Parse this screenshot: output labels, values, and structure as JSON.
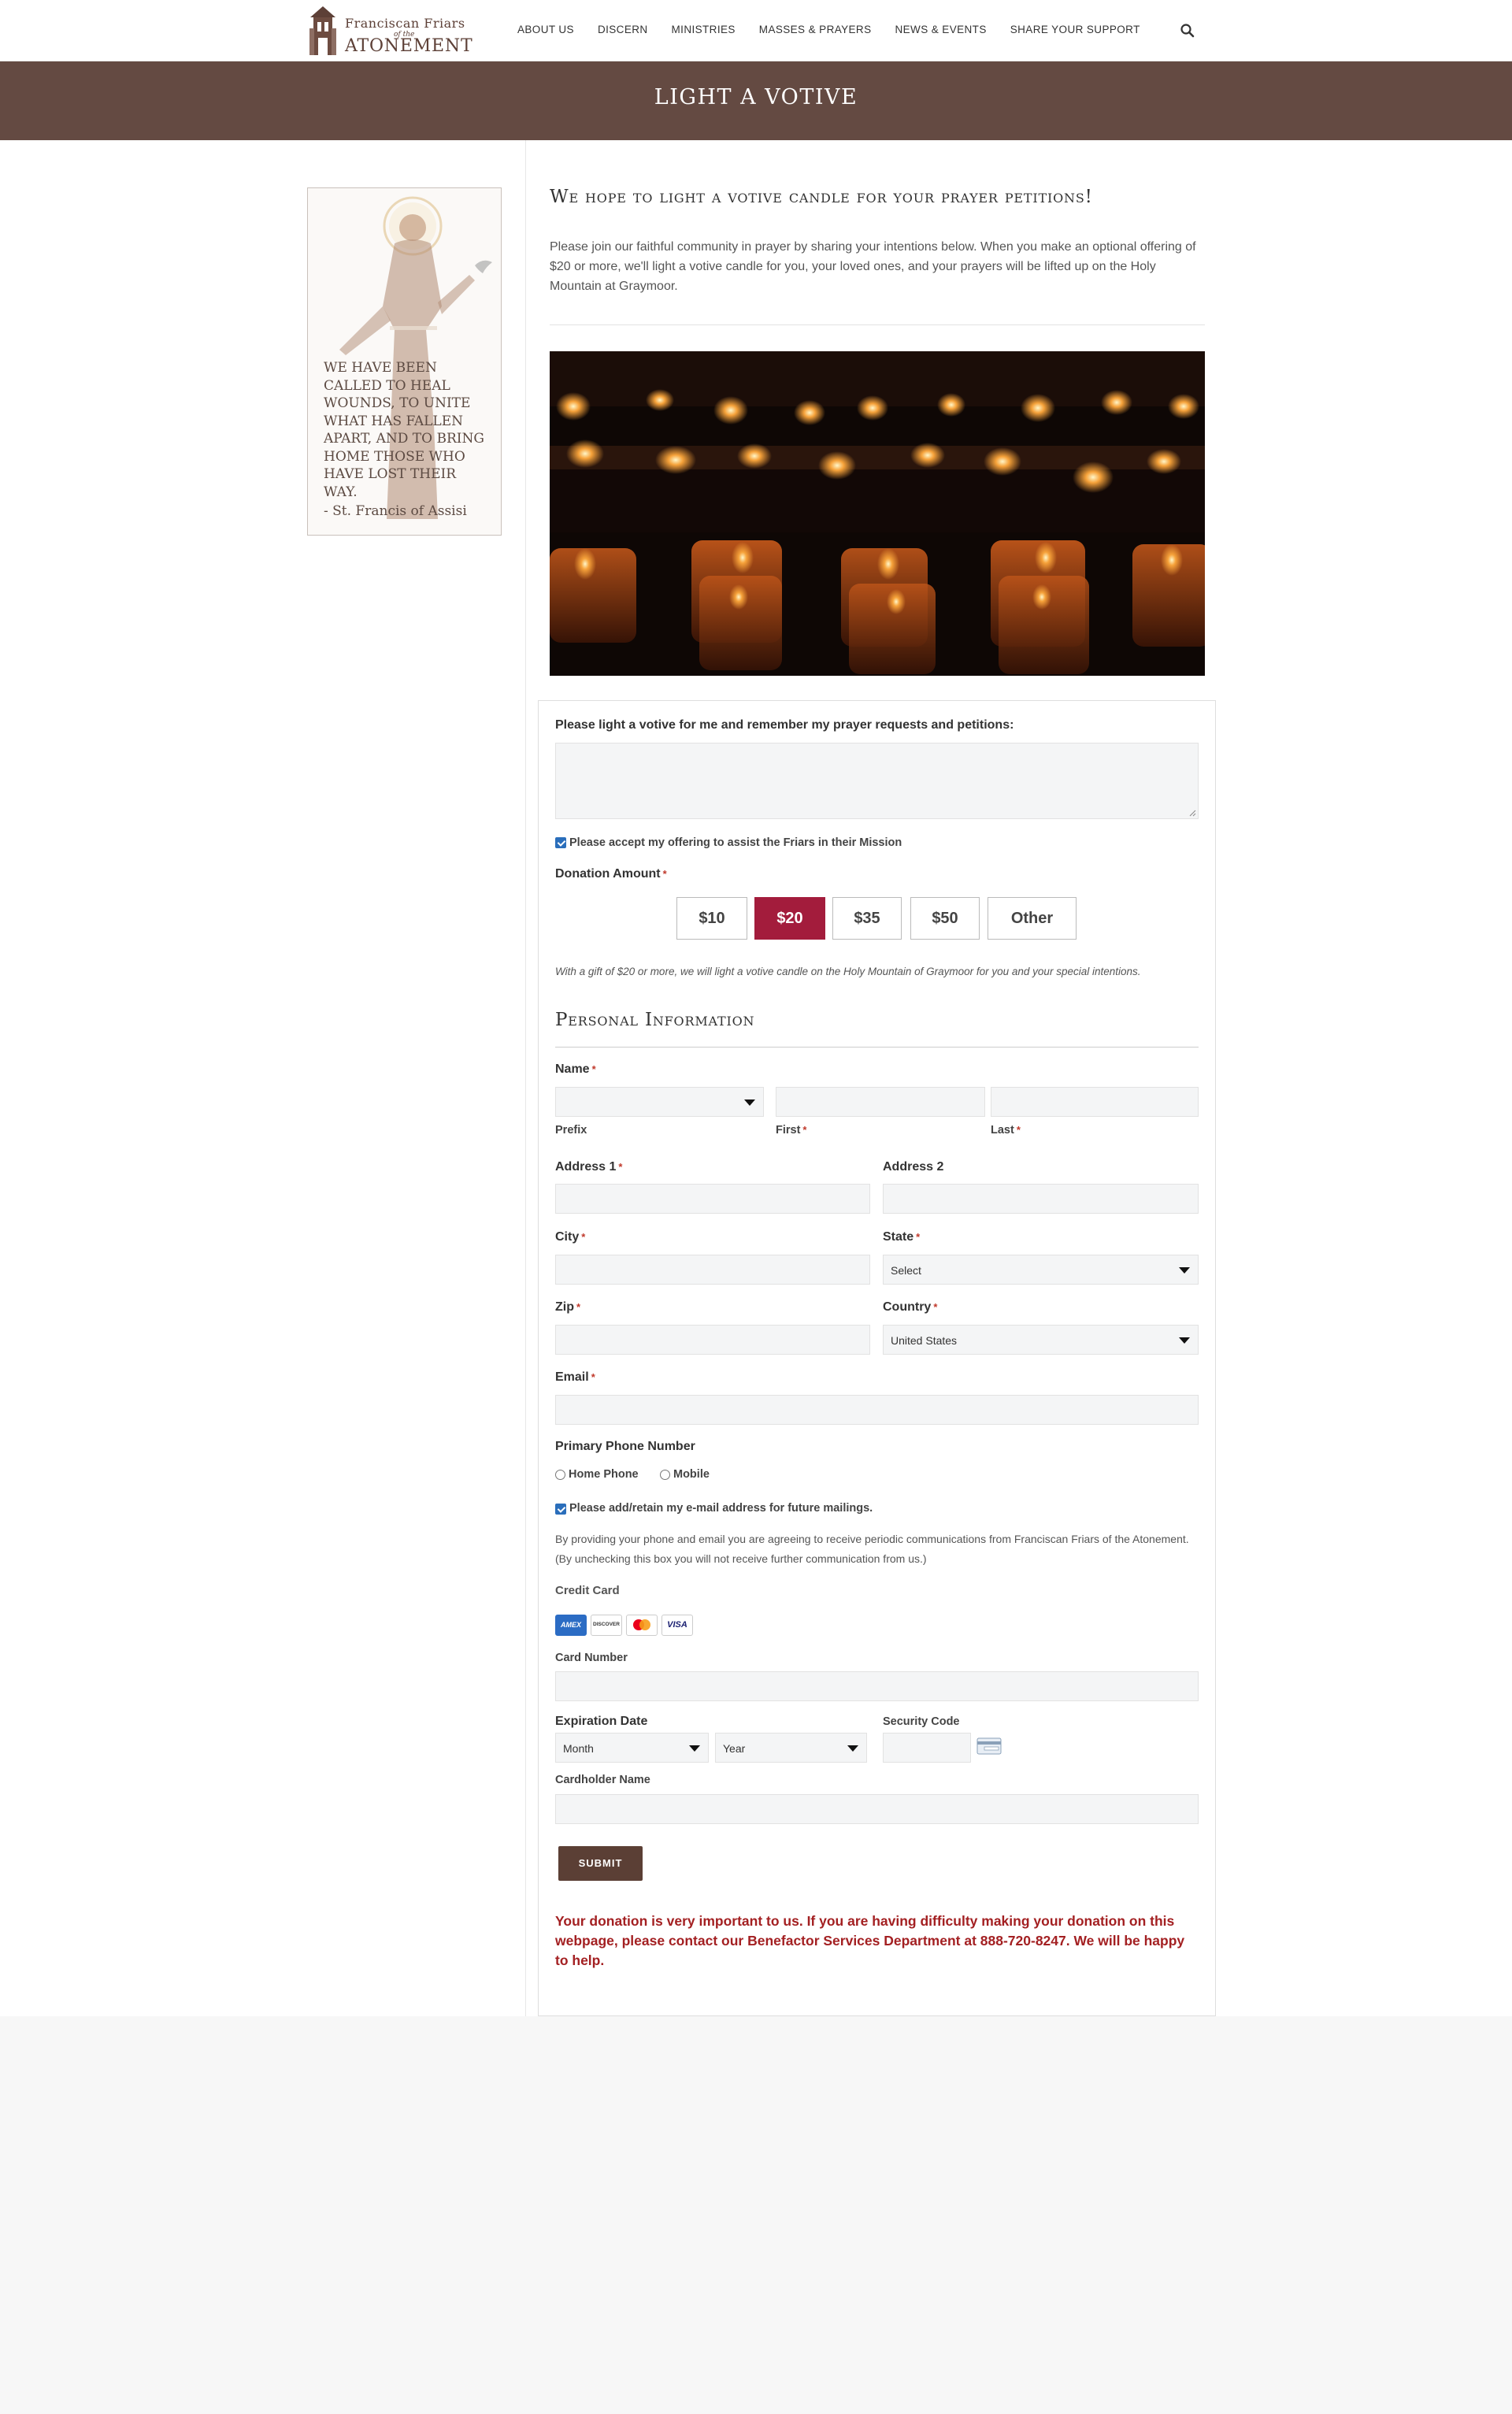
{
  "header": {
    "logo": {
      "line1": "Franciscan Friars",
      "line2": "of the",
      "line3": "Atonement"
    },
    "nav": [
      "ABOUT US",
      "DISCERN",
      "MINISTRIES",
      "MASSES & PRAYERS",
      "NEWS & EVENTS",
      "SHARE YOUR SUPPORT"
    ],
    "search_icon": "search-icon"
  },
  "banner": {
    "title": "Light a Votive"
  },
  "sidebar": {
    "quote": "We have been called to heal wounds, to unite what has fallen apart, and to bring home those who have lost their way.",
    "author": "- St. Francis of Assisi"
  },
  "intro": {
    "heading": "We hope to light a votive candle for your prayer petitions!",
    "text": "Please join our faithful community in prayer by sharing your intentions below. When you make an optional offering of $20 or more, we'll light a votive candle for you, your loved ones, and your prayers will be lifted up on the Holy Mountain at Graymoor."
  },
  "form": {
    "petitions_label": "Please light a votive for me and remember my prayer requests and petitions:",
    "offering_checkbox_label": "Please accept my offering to assist the Friars in their Mission",
    "donation_label": "Donation Amount",
    "amounts": [
      "$10",
      "$20",
      "$35",
      "$50",
      "Other"
    ],
    "selected_amount": "$20",
    "gift_note": "With a gift of $20 or more, we will light a votive candle on the Holy Mountain of Graymoor for you and your special intentions.",
    "personal_heading": "Personal Information",
    "name_label": "Name",
    "prefix_label": "Prefix",
    "first_label": "First",
    "last_label": "Last",
    "address1_label": "Address 1",
    "address2_label": "Address 2",
    "city_label": "City",
    "state_label": "State",
    "state_value": "Select",
    "zip_label": "Zip",
    "country_label": "Country",
    "country_value": "United States",
    "email_label": "Email",
    "phone_label": "Primary Phone Number",
    "phone_options": [
      "Home Phone",
      "Mobile"
    ],
    "mailing_checkbox_label": "Please add/retain my e-mail address for future mailings.",
    "consent_text": "By providing your phone and email you are agreeing to receive periodic communications from Franciscan Friars of the Atonement. (By unchecking this box you will not receive further communication from us.)",
    "credit_card_label": "Credit Card",
    "card_brands": [
      "AMEX",
      "DISCOVER",
      "mastercard",
      "VISA"
    ],
    "card_number_label": "Card Number",
    "expiration_label": "Expiration Date",
    "month_value": "Month",
    "year_value": "Year",
    "security_label": "Security Code",
    "cardholder_label": "Cardholder Name",
    "submit_label": "SUBMIT",
    "help_text": "Your donation is very important to us. If you are having difficulty making your donation on this webpage, please contact our Benefactor Services Department at 888-720-8247. We will be happy to help."
  },
  "colors": {
    "banner": "#644a42",
    "accent": "#a31c3c",
    "help_text": "#a32022",
    "button": "#5b3f35"
  }
}
